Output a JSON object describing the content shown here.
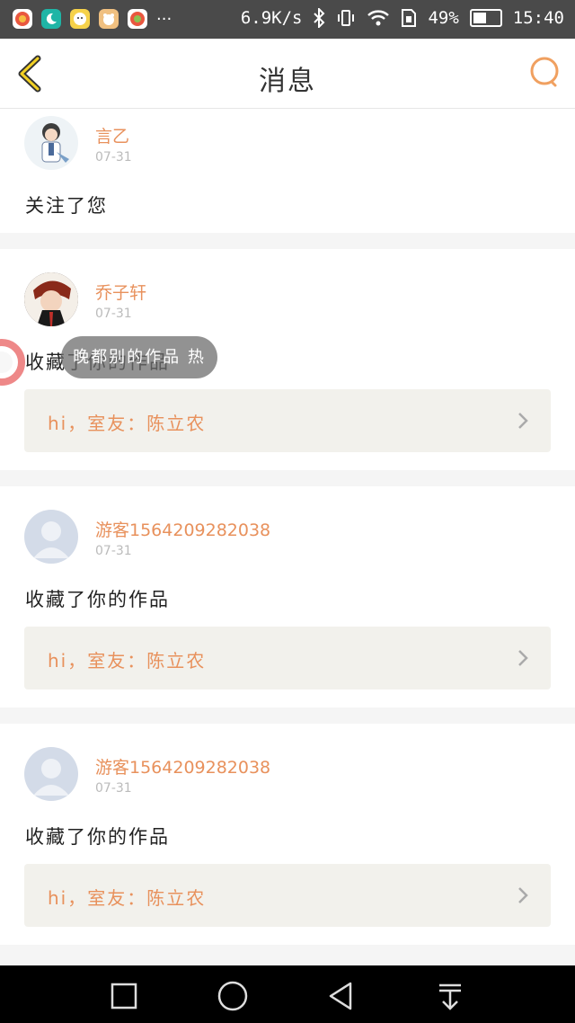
{
  "status_bar": {
    "speed": "6.9K/s",
    "battery_pct": "49%",
    "time": "15:40",
    "more": "···"
  },
  "header": {
    "title": "消息"
  },
  "notifications": [
    {
      "user": "言乙",
      "date": "07-31",
      "action": "关注了您"
    },
    {
      "user": "乔子轩",
      "date": "07-31",
      "action": "收藏了你的作品",
      "work_title": "hi，室友：陈立农"
    },
    {
      "user": "游客1564209282038",
      "date": "07-31",
      "action": "收藏了你的作品",
      "work_title": "hi，室友：陈立农"
    },
    {
      "user": "游客1564209282038",
      "date": "07-31",
      "action": "收藏了你的作品",
      "work_title": "hi，室友：陈立农"
    }
  ],
  "toast": {
    "text": "晚都别的作品 热"
  },
  "colors": {
    "accent": "#e8915c",
    "header_back": "#e6b800",
    "work_bg": "#f2f1ec"
  }
}
